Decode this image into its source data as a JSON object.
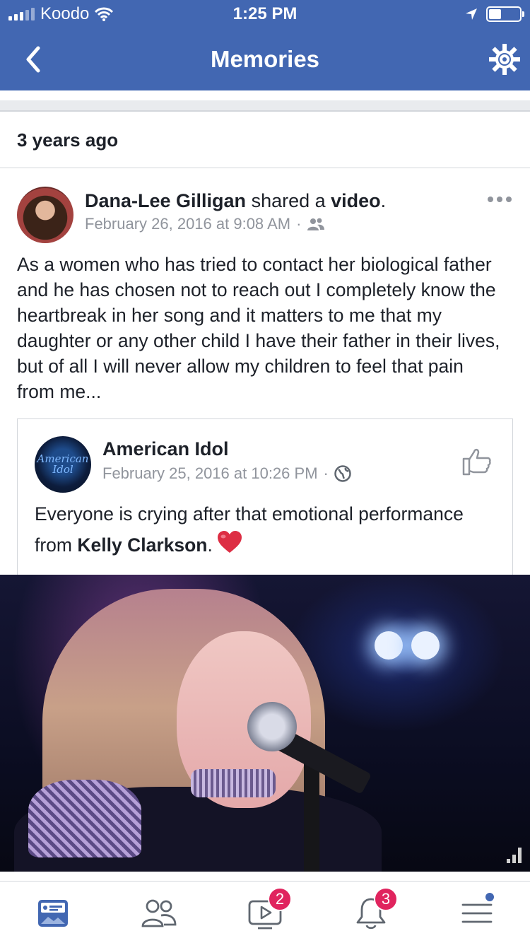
{
  "status_bar": {
    "carrier": "Koodo",
    "time": "1:25 PM"
  },
  "nav": {
    "title": "Memories",
    "back_icon": "chevron-left-icon",
    "settings_icon": "gear-icon"
  },
  "section": {
    "heading": "3 years ago"
  },
  "post": {
    "author": "Dana-Lee Gilligan",
    "action_text": " shared a ",
    "object": "video",
    "object_suffix": ".",
    "timestamp": "February 26, 2016 at 9:08 AM",
    "separator": "·",
    "audience_icon": "friends-icon",
    "body": "As a women who has tried to contact her biological father and he has chosen not to reach out I completely know the heartbreak in her song and it matters to me that my daughter or any other child I have their father in their lives, but of all I will never allow my children to feel that pain from me...",
    "shared": {
      "page_name": "American Idol",
      "logo_text": "American Idol",
      "timestamp": "February 25, 2016 at 10:26 PM",
      "separator": "·",
      "audience_icon": "globe-icon",
      "text_before": "Everyone is crying after that emotional performance from ",
      "text_bold": "Kelly Clarkson",
      "text_after": ".",
      "emoji": "heart-emoji"
    }
  },
  "tabbar": {
    "items": [
      {
        "name": "news-feed",
        "icon": "news-feed-icon",
        "active": true
      },
      {
        "name": "friends",
        "icon": "friends-icon",
        "active": false
      },
      {
        "name": "watch",
        "icon": "watch-icon",
        "badge": "2"
      },
      {
        "name": "notifications",
        "icon": "bell-icon",
        "badge": "3"
      },
      {
        "name": "menu",
        "icon": "menu-icon",
        "dot": true
      }
    ]
  },
  "colors": {
    "brand": "#4267b2",
    "badge": "#e0245e",
    "meta_text": "#90949c"
  }
}
